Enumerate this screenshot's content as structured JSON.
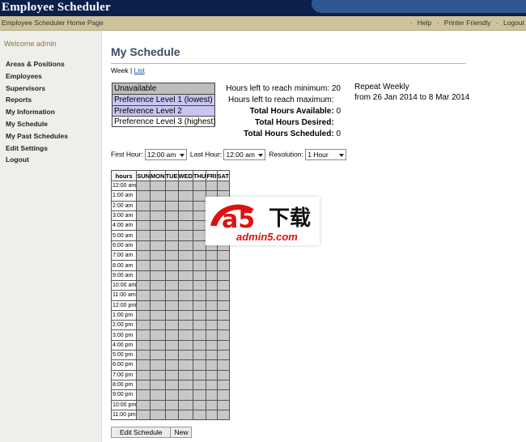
{
  "app": {
    "title": "Employee Scheduler"
  },
  "navbar": {
    "home": "Employee Scheduler Home Page",
    "links": [
      "Help",
      "Printer Friendly",
      "Logout"
    ]
  },
  "sidebar": {
    "welcome": "Welcome admin",
    "items": [
      {
        "label": "Areas & Positions"
      },
      {
        "label": "Employees"
      },
      {
        "label": "Supervisors"
      },
      {
        "label": "Reports"
      },
      {
        "label": "My Information"
      },
      {
        "label": "My Schedule"
      },
      {
        "label": "My Past Schedules"
      },
      {
        "label": "Edit Settings"
      },
      {
        "label": "Logout"
      }
    ]
  },
  "main": {
    "title": "My Schedule",
    "view": {
      "week": "Week",
      "sep": "|",
      "list": "List"
    },
    "legend": [
      "Unavailable",
      "Preference Level 1 (lowest)",
      "Preference Level 2",
      "Preference Level 3 (highest)"
    ],
    "hours": {
      "min_label": "Hours left to reach minimum:",
      "min_value": "20",
      "max_label": "Hours left to reach maximum:",
      "max_value": "",
      "avail_label": "Total Hours Available:",
      "avail_value": "0",
      "desired_label": "Total Hours Desired:",
      "desired_value": "",
      "sched_label": "Total Hours Scheduled:",
      "sched_value": "0"
    },
    "repeat": {
      "line1": "Repeat Weekly",
      "line2": "from 26 Jan 2014 to 8 Mar 2014"
    },
    "controls": {
      "first_label": "First Hour:",
      "first_value": "12:00 am",
      "last_label": "Last Hour:",
      "last_value": "12:00 am",
      "res_label": "Resolution:",
      "res_value": "1 Hour"
    },
    "grid": {
      "header": "hours",
      "days": [
        "SUN",
        "MON",
        "TUE",
        "WED",
        "THU",
        "FRI",
        "SAT"
      ],
      "hours": [
        "12:00 am",
        "1:00 am",
        "2:00 am",
        "3:00 am",
        "4:00 am",
        "5:00 am",
        "6:00 am",
        "7:00 am",
        "8:00 am",
        "9:00 am",
        "10:00 am",
        "11:00 am",
        "12:00 pm",
        "1:00 pm",
        "2:00 pm",
        "3:00 pm",
        "4:00 pm",
        "5:00 pm",
        "6:00 pm",
        "7:00 pm",
        "8:00 pm",
        "9:00 pm",
        "10:00 pm",
        "11:00 pm"
      ]
    },
    "buttons": {
      "edit": "Edit Schedule",
      "new": "New"
    }
  },
  "watermark": {
    "logo": "a5",
    "dl": "下载",
    "domain": "admin5.com"
  },
  "colors": {
    "header": "#0c1f4a",
    "navbar": "#cdc29a",
    "sidebar": "#eeeeea",
    "title": "#3c4b67",
    "cell": "#c8c8c8",
    "pref": "#cac6f2"
  }
}
